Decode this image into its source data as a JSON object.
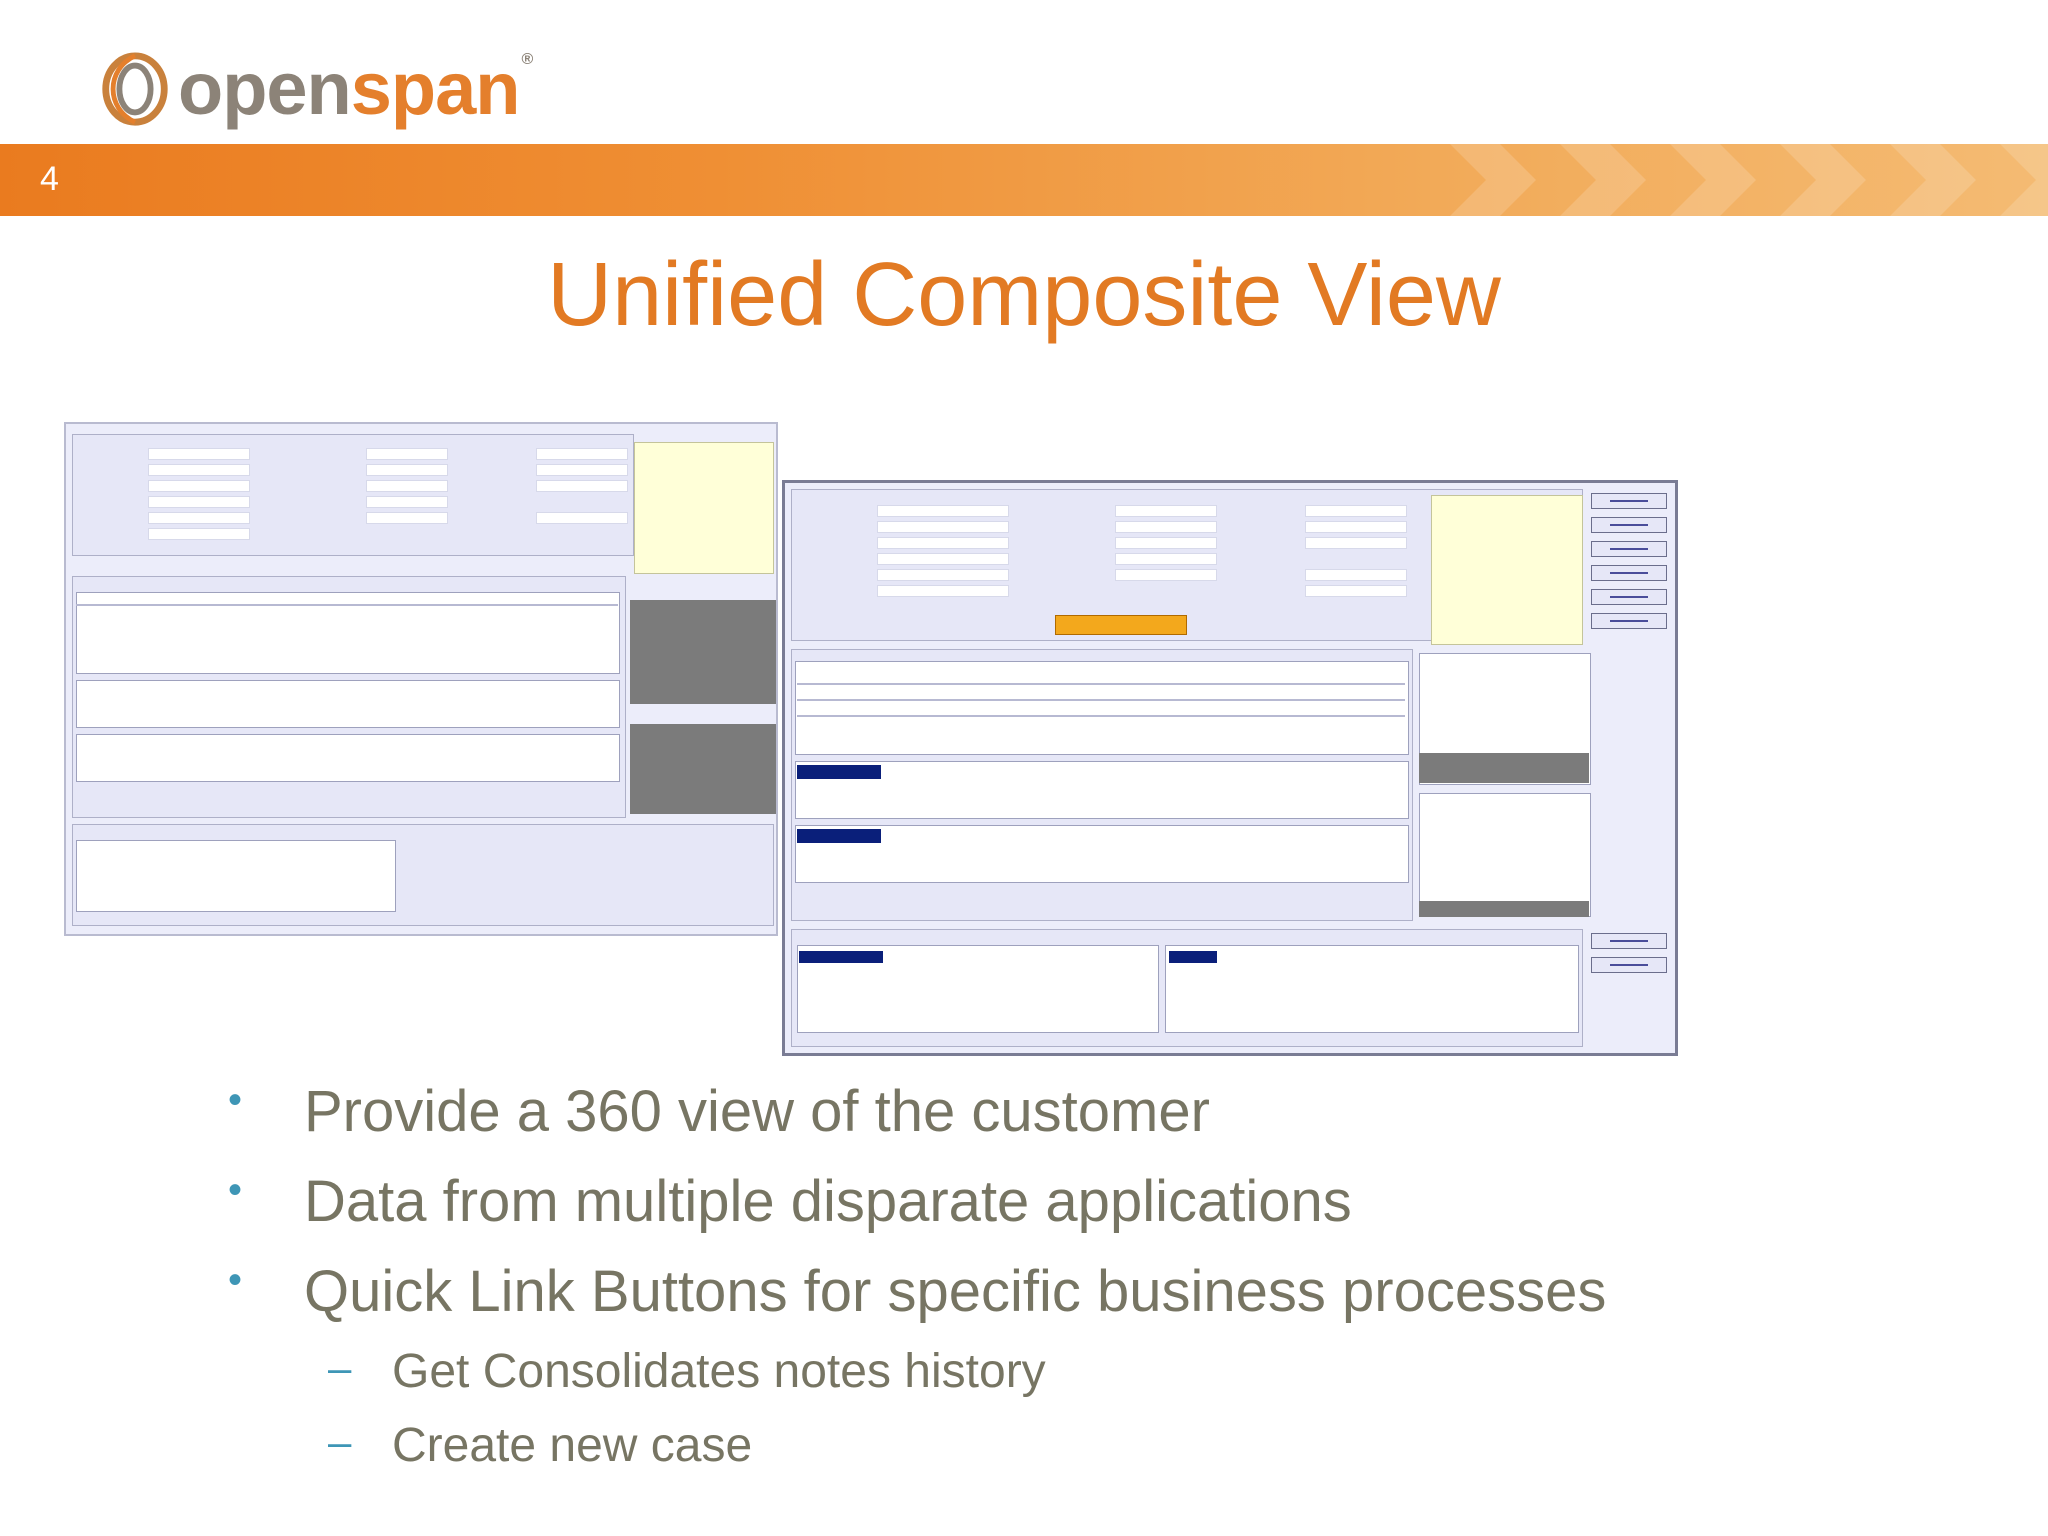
{
  "header": {
    "logo_text_1": "open",
    "logo_text_2": "span",
    "logo_mark": "openspan-swirl-logo",
    "page_number": "4"
  },
  "title": "Unified Composite View",
  "colors": {
    "accent": "#e27a23",
    "bullet": "#3e96b6",
    "body_text": "#777563",
    "banner_start": "#ea7b1f",
    "banner_end": "#f4bb73"
  },
  "bullets": [
    {
      "text": "Provide a 360 view of the customer"
    },
    {
      "text": "Data from multiple disparate applications"
    },
    {
      "text": "Quick Link Buttons for specific business processes"
    }
  ],
  "sub_bullets": [
    {
      "text": "Get Consolidates notes history"
    },
    {
      "text": "Create new case"
    }
  ],
  "screenshots": {
    "back": {
      "description": "blank composite customer view form"
    },
    "front": {
      "description": "populated composite customer view form"
    }
  }
}
